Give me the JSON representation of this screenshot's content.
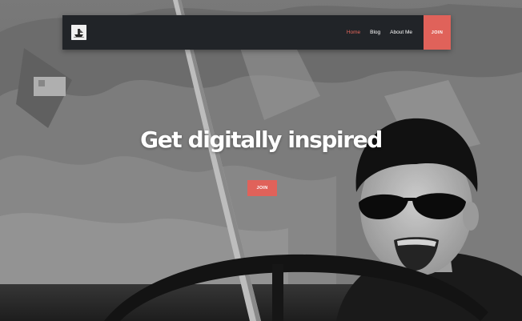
{
  "hero": {
    "headline": "Get digitally inspired",
    "cta_label": "JOIN"
  },
  "nav": {
    "items": [
      {
        "label": "Home",
        "active": true
      },
      {
        "label": "Blog",
        "active": false
      },
      {
        "label": "About Me",
        "active": false
      }
    ],
    "join_label": "JOIN"
  },
  "colors": {
    "accent": "#e0625a",
    "navbar_bg": "#212428",
    "active_link": "#e8675c",
    "text": "#ffffff"
  },
  "icons": {
    "logo": "ship-logo-icon"
  }
}
